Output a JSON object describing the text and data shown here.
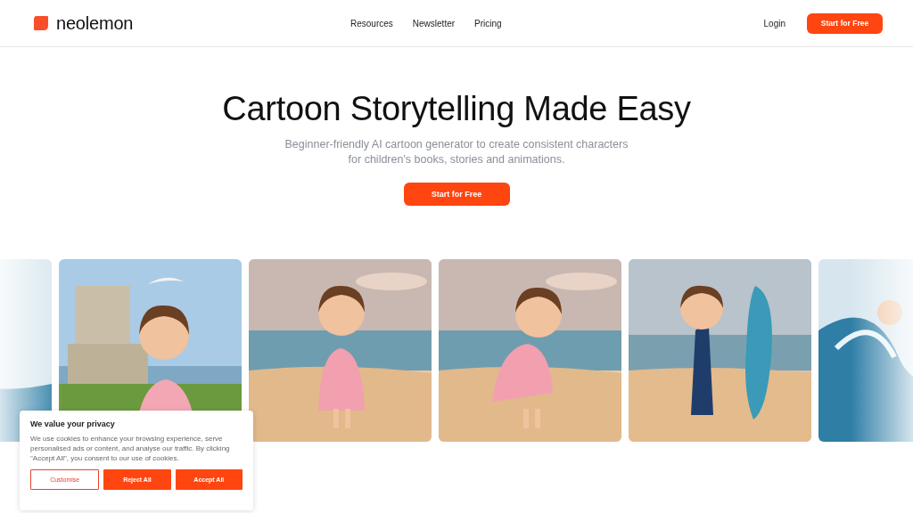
{
  "header": {
    "logo": "neolemon",
    "nav": [
      "Resources",
      "Newsletter",
      "Pricing"
    ],
    "login": "Login",
    "cta": "Start for Free"
  },
  "hero": {
    "title": "Cartoon Storytelling Made Easy",
    "subtitle": "Beginner-friendly AI cartoon generator to create consistent characters for children's books, stories and animations.",
    "cta": "Start for Free"
  },
  "cookie_banner": {
    "title": "We value your privacy",
    "text": "We use cookies to enhance your browsing experience, serve personalised ads or content, and analyse our traffic. By clicking \"Accept All\", you consent to our use of cookies.",
    "buttons": [
      {
        "label": "Customise",
        "kind": "outline"
      },
      {
        "label": "Reject All",
        "kind": "filled"
      },
      {
        "label": "Accept All",
        "kind": "filled"
      }
    ]
  }
}
